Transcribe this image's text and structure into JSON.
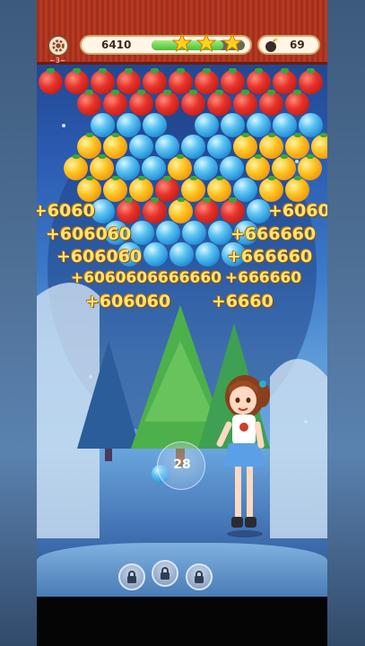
{
  "header": {
    "level_label": "~3~",
    "score": "6410",
    "progress_fraction": 0.77,
    "stars_earned": 3,
    "bombs_count": "69"
  },
  "colors": {
    "header_red": "#b63a22",
    "tomato": "#e8322a",
    "blue_bubble": "#1c86d2",
    "orange_bubble": "#ffc21e",
    "popup_gold": "#ffe476"
  },
  "popups": [
    "+6060",
    "+6060",
    "+606060",
    "+666660",
    "+606060",
    "+666660",
    "+6060606666660",
    "+666660",
    "+606060",
    "+6660"
  ],
  "shooter": {
    "shots_left": "28",
    "next_bubble": "blue"
  },
  "boosters": [
    {
      "name": "lock-icon",
      "locked": true
    },
    {
      "name": "lock-icon",
      "locked": true
    },
    {
      "name": "lock-icon",
      "locked": true
    }
  ]
}
